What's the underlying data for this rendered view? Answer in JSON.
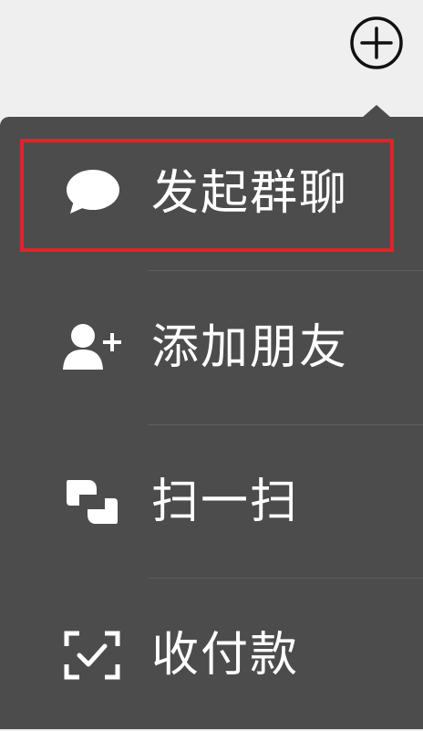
{
  "toolbar": {
    "plus_icon": "plus-circle-icon"
  },
  "menu": {
    "items": [
      {
        "label": "发起群聊",
        "icon": "chat-bubble-icon"
      },
      {
        "label": "添加朋友",
        "icon": "add-user-icon"
      },
      {
        "label": "扫一扫",
        "icon": "scan-icon"
      },
      {
        "label": "收付款",
        "icon": "payment-scan-icon"
      }
    ],
    "highlight_color": "#e0242b",
    "background_color": "#4c4c4c"
  }
}
